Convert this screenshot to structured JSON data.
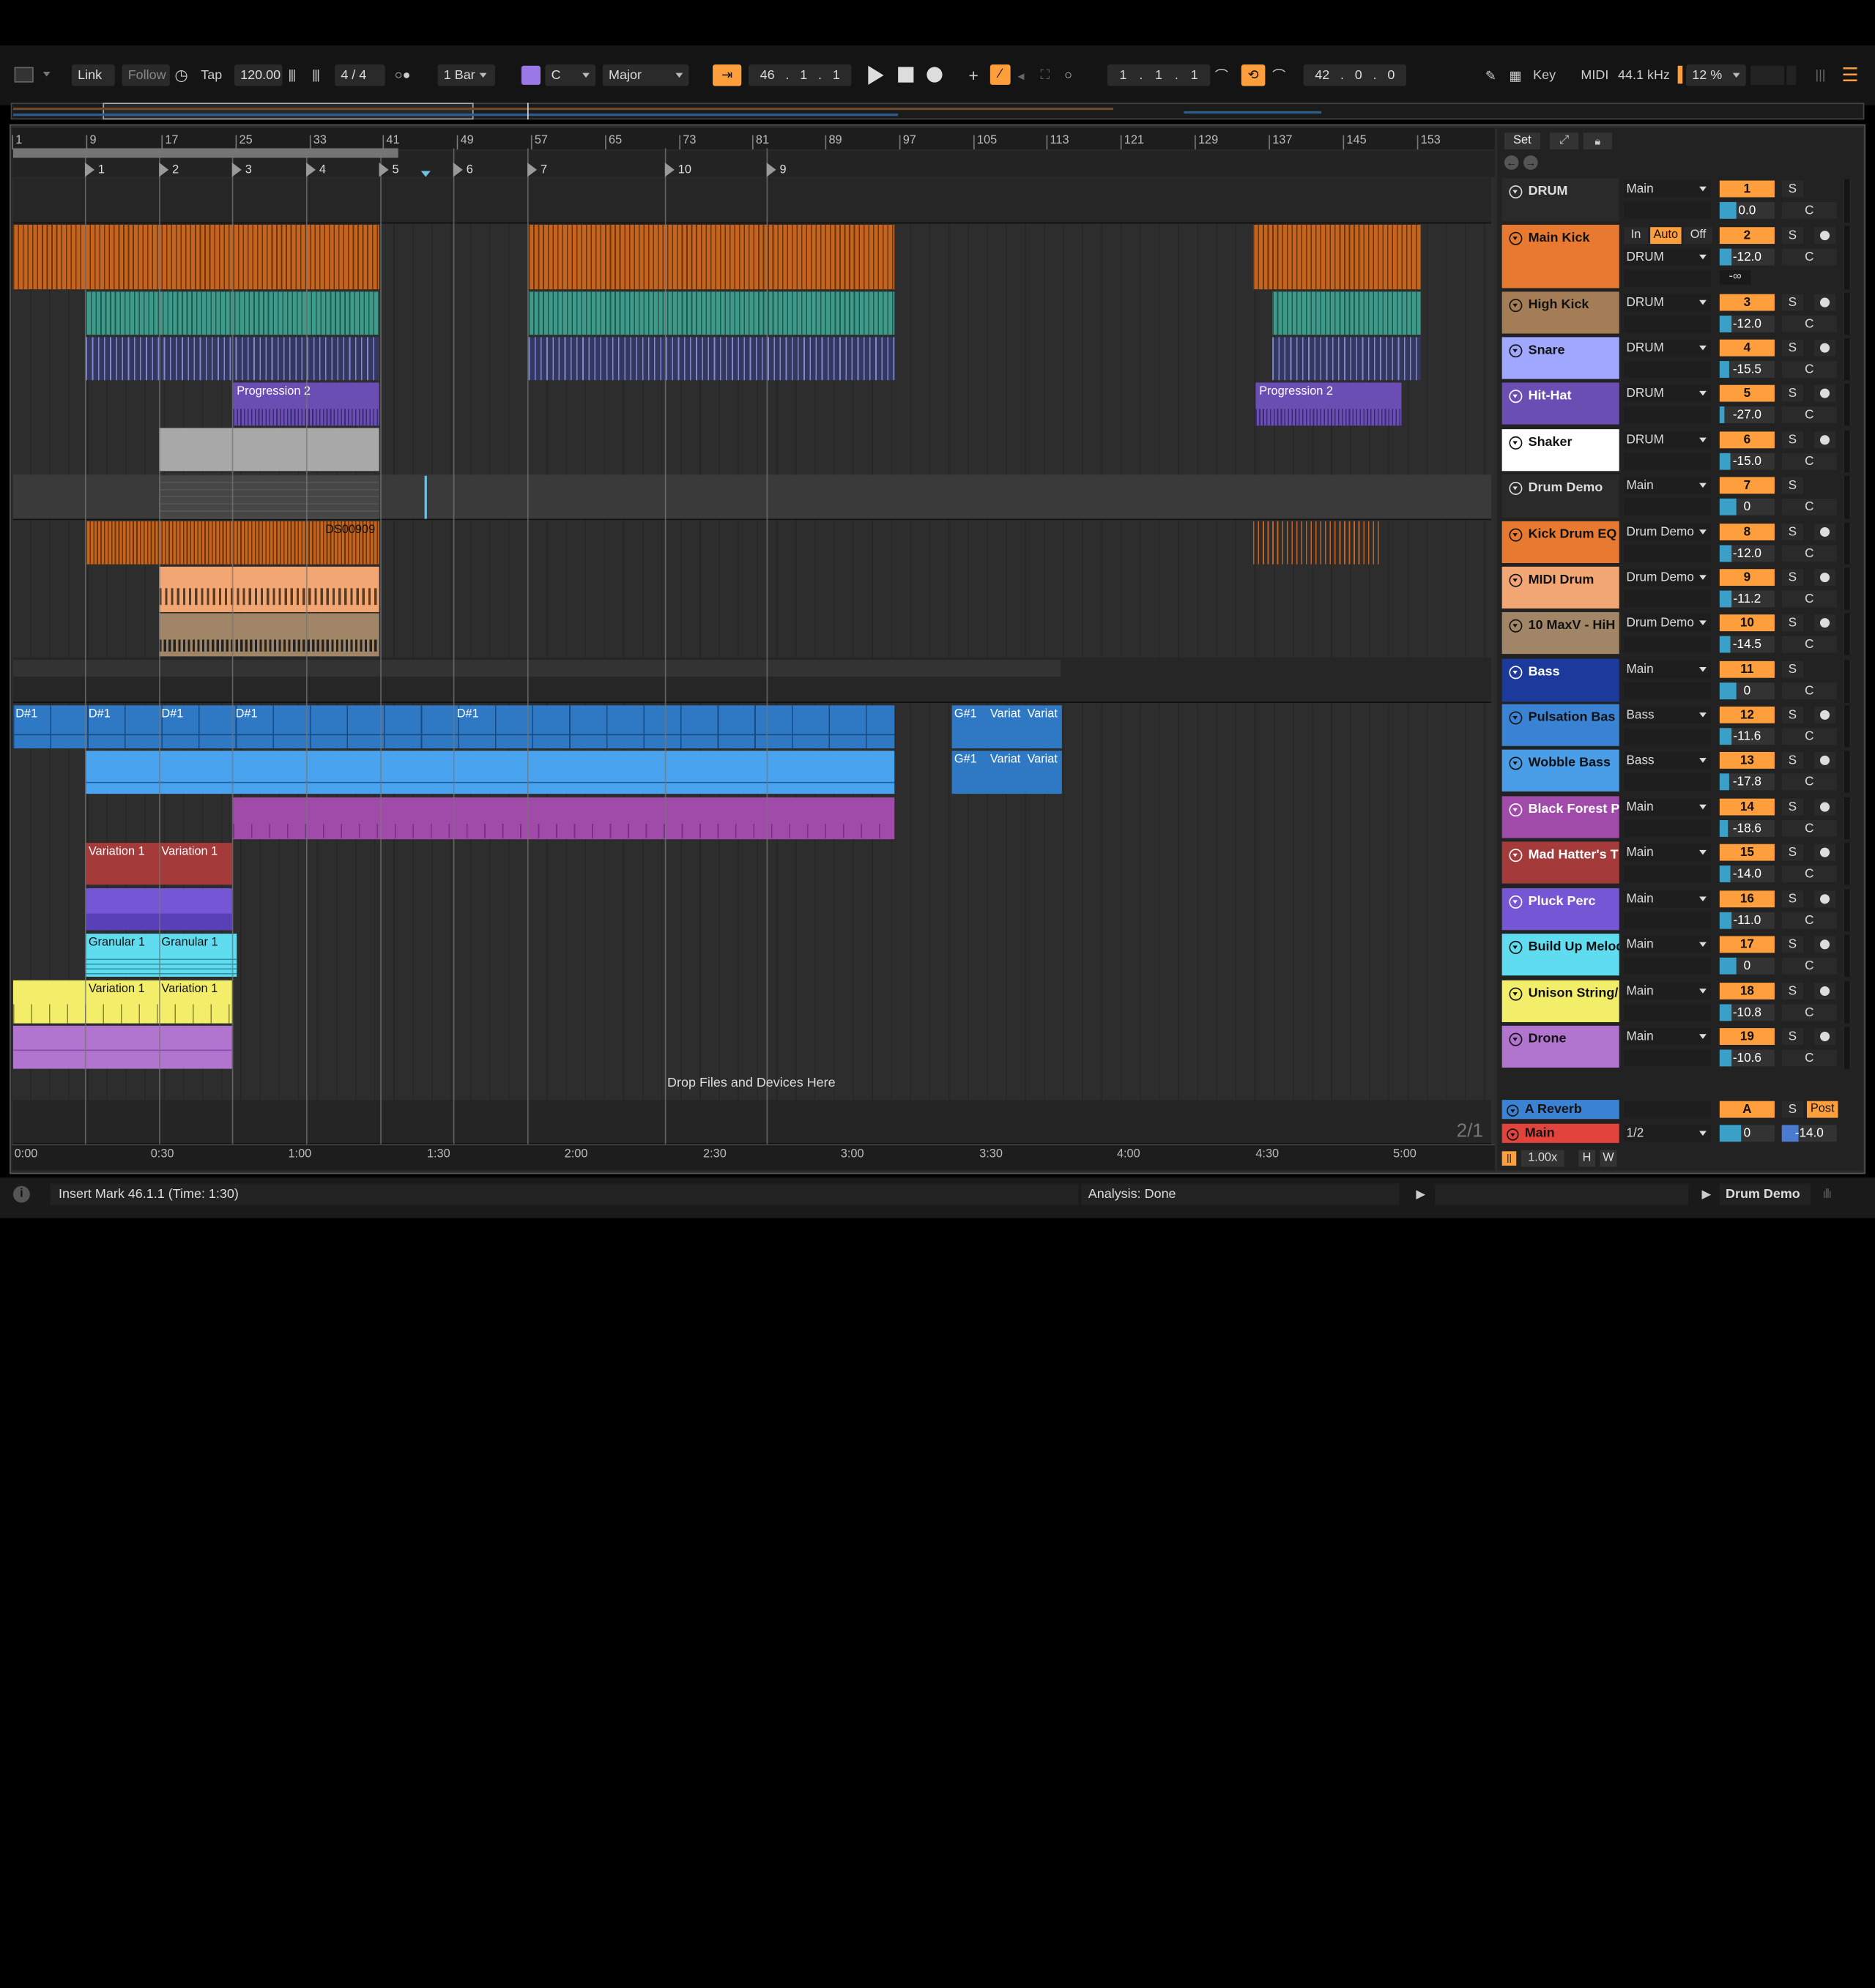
{
  "transport": {
    "link": "Link",
    "follow": "Follow",
    "tap": "Tap",
    "tempo": "120.00",
    "sig": "4 / 4",
    "quant": "1 Bar",
    "key": "C",
    "scale": "Major",
    "pos_b": "46",
    "pos_s": "1",
    "pos_t": "1",
    "loop_b": "1",
    "loop_s": "1",
    "loop_t": "1",
    "len_b": "42",
    "len_s": "0",
    "len_t": "0",
    "key_btn": "Key",
    "midi_btn": "MIDI",
    "sample_rate": "44.1 kHz",
    "cpu": "12 %"
  },
  "ruler": [
    "1",
    "9",
    "17",
    "25",
    "33",
    "41",
    "49",
    "57",
    "65",
    "73",
    "81",
    "89",
    "97",
    "105",
    "113",
    "121",
    "129",
    "137",
    "145",
    "153"
  ],
  "markers": [
    "1",
    "2",
    "3",
    "4",
    "5",
    "6",
    "7",
    "10",
    "9"
  ],
  "time_ruler": [
    "0:00",
    "0:30",
    "1:00",
    "1:30",
    "2:00",
    "2:30",
    "3:00",
    "3:30",
    "4:00",
    "4:30",
    "5:00"
  ],
  "clips": {
    "prog1": "Progression 2",
    "prog2": "Progression 2",
    "ds": "DS00909",
    "d1": "D#1",
    "d2": "D#1",
    "d3": "D#1",
    "d4": "D#1",
    "d5": "D#1",
    "g1": "G#1",
    "v1": "Variat",
    "v2": "Variat",
    "g2": "G#1",
    "v3": "Variat",
    "v4": "Variat",
    "red1": "Variation 1",
    "red2": "Variation 1",
    "gr1": "Granular 1",
    "gr2": "Granular 1",
    "y1": "Variation 1",
    "y2": "Variation 1"
  },
  "drop_hint": "Drop Files and Devices Here",
  "page_counter": "2/1",
  "mixer_header": {
    "set": "Set"
  },
  "tracks": [
    {
      "name": "DRUM",
      "color": "#2a2a2a",
      "text": "#ddd",
      "route": "Main",
      "num": "1",
      "vol": "0.0"
    },
    {
      "name": "Main Kick",
      "color": "#e77a30",
      "text": "#111",
      "route": "DRUM",
      "num": "2",
      "vol": "-12.0"
    },
    {
      "name": "High Kick",
      "color": "#a47d57",
      "text": "#111",
      "route": "DRUM",
      "num": "3",
      "vol": "-12.0"
    },
    {
      "name": "Snare",
      "color": "#9fa7ff",
      "text": "#111",
      "route": "DRUM",
      "num": "4",
      "vol": "-15.5"
    },
    {
      "name": "Hit-Hat",
      "color": "#6a4eb4",
      "text": "#fff",
      "route": "DRUM",
      "num": "5",
      "vol": "-27.0"
    },
    {
      "name": "Shaker",
      "color": "#ffffff",
      "text": "#111",
      "route": "DRUM",
      "num": "6",
      "vol": "-15.0"
    },
    {
      "name": "Drum Demo",
      "color": "#2a2a2a",
      "text": "#ddd",
      "route": "Main",
      "num": "7",
      "vol": "0"
    },
    {
      "name": "Kick Drum EQ",
      "color": "#e77a30",
      "text": "#111",
      "route": "Drum Demo",
      "num": "8",
      "vol": "-12.0"
    },
    {
      "name": "MIDI Drum",
      "color": "#f2a673",
      "text": "#111",
      "route": "Drum Demo",
      "num": "9",
      "vol": "-11.2"
    },
    {
      "name": "10 MaxV - HiH",
      "color": "#a08567",
      "text": "#111",
      "route": "Drum Demo",
      "num": "10",
      "vol": "-14.5"
    },
    {
      "name": "Bass",
      "color": "#1b3a9c",
      "text": "#fff",
      "route": "Main",
      "num": "11",
      "vol": "0"
    },
    {
      "name": "Pulsation Bas",
      "color": "#3a83d4",
      "text": "#111",
      "route": "Bass",
      "num": "12",
      "vol": "-11.6"
    },
    {
      "name": "Wobble Bass",
      "color": "#4a9ee8",
      "text": "#111",
      "route": "Bass",
      "num": "13",
      "vol": "-17.8"
    },
    {
      "name": "Black Forest Pi",
      "color": "#a04aaa",
      "text": "#fff",
      "route": "Main",
      "num": "14",
      "vol": "-18.6"
    },
    {
      "name": "Mad Hatter's T",
      "color": "#a53a3a",
      "text": "#fff",
      "route": "Main",
      "num": "15",
      "vol": "-14.0"
    },
    {
      "name": "Pluck Perc",
      "color": "#7557d6",
      "text": "#fff",
      "route": "Main",
      "num": "16",
      "vol": "-11.0"
    },
    {
      "name": "Build Up Melod",
      "color": "#5fdcf0",
      "text": "#111",
      "route": "Main",
      "num": "17",
      "vol": "0"
    },
    {
      "name": "Unison String/",
      "color": "#f2ee6a",
      "text": "#111",
      "route": "Main",
      "num": "18",
      "vol": "-10.8"
    },
    {
      "name": "Drone",
      "color": "#b174cf",
      "text": "#111",
      "route": "Main",
      "num": "19",
      "vol": "-10.6"
    }
  ],
  "kick_io": {
    "in": "In",
    "auto": "Auto",
    "off": "Off",
    "neg_inf": "-∞"
  },
  "returns": {
    "reverb": "A Reverb",
    "reverb_num": "A",
    "post": "Post",
    "main": "Main",
    "main_route": "1/2",
    "main_num": "0",
    "main_vol": "-14.0"
  },
  "zoom": "1.00x",
  "hw": {
    "h": "H",
    "w": "W"
  },
  "status": {
    "msg": "Insert Mark 46.1.1 (Time: 1:30)",
    "analysis": "Analysis: Done",
    "device": "Drum Demo"
  }
}
